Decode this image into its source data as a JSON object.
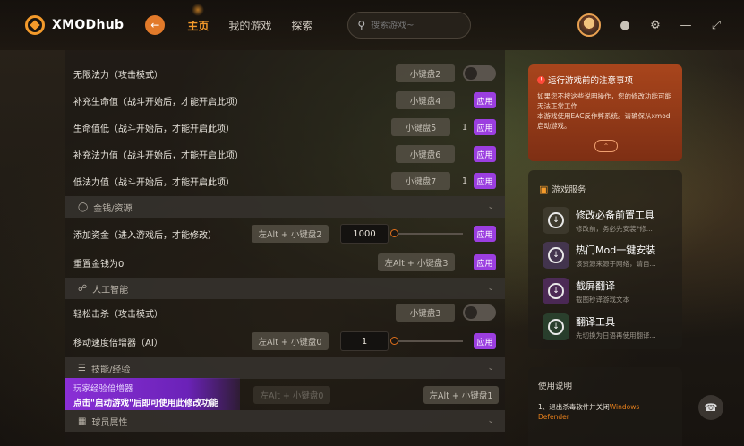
{
  "app": {
    "logo_text": "XMODhub"
  },
  "nav": {
    "items": [
      "主页",
      "我的游戏",
      "探索"
    ],
    "active_index": 0
  },
  "search": {
    "placeholder": "搜索游戏~"
  },
  "rows": [
    {
      "label": "无限法力（攻击模式）",
      "key": "小键盘2",
      "control": "toggle"
    },
    {
      "label": "补充生命值（战斗开始后，才能开启此项）",
      "key": "小键盘4",
      "control": "apply"
    },
    {
      "label": "生命值低（战斗开始后，才能开启此项）",
      "key": "小键盘5",
      "count": "1",
      "control": "apply"
    },
    {
      "label": "补充法力值（战斗开始后，才能开启此项）",
      "key": "小键盘6",
      "control": "apply"
    },
    {
      "label": "低法力值（战斗开始后，才能开启此项）",
      "key": "小键盘7",
      "count": "1",
      "control": "apply"
    }
  ],
  "sections": {
    "money": "金钱/资源",
    "ai": "人工智能",
    "skills": "技能/经验",
    "players": "球员属性"
  },
  "money_rows": [
    {
      "label": "添加资金（进入游戏后，才能修改）",
      "key": "左Alt + 小键盘2",
      "value": "1000",
      "control": "apply"
    },
    {
      "label": "重置金钱为0",
      "key": "左Alt + 小键盘3",
      "control": "apply"
    }
  ],
  "ai_rows": [
    {
      "label": "轻松击杀（攻击模式）",
      "key": "小键盘3",
      "control": "toggle"
    },
    {
      "label": "移动速度倍增器（AI）",
      "key": "左Alt + 小键盘0",
      "value": "1",
      "control": "apply"
    }
  ],
  "skills_row": {
    "key_left": "左Alt + 小键盘0",
    "key_right": "左Alt + 小键盘1"
  },
  "apply_label": "应用",
  "banner": {
    "line1": "玩家经验倍增器",
    "line2": "点击\"启动游戏\"后即可使用此修改功能"
  },
  "notice": {
    "title": "运行游戏前的注意事项",
    "body": "如果您不按这些说明操作，您的修改功能可能无法正常工作\n本游戏使用EAC反作弊系统。请确保从xmod启动游戏。"
  },
  "services": {
    "title": "游戏服务",
    "items": [
      {
        "name": "修改必备前置工具",
        "desc": "修改前，务必先安装*修..."
      },
      {
        "name": "热门Mod一键安装",
        "desc": "该资源来源于网络，请自..."
      },
      {
        "name": "截屏翻译",
        "desc": "截图秒译游戏文本"
      },
      {
        "name": "翻译工具",
        "desc": "先切换为日语再使用翻译..."
      }
    ]
  },
  "usage": {
    "title": "使用说明",
    "item_prefix": "1、退出杀毒软件并关闭",
    "item_highlight": "Windows Defender"
  },
  "colors": {
    "accent": "#f39a2b",
    "apply": "#9b3ee0",
    "notice": "#a8451c"
  }
}
